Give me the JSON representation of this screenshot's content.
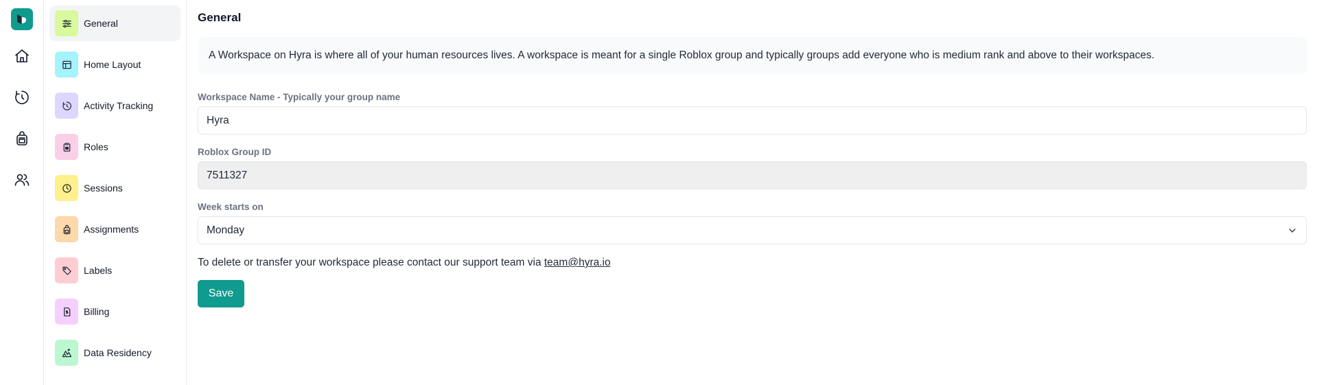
{
  "rail": {
    "logo": "hyra-logo",
    "items": [
      {
        "icon": "home-icon"
      },
      {
        "icon": "activity-icon"
      },
      {
        "icon": "backpack-icon"
      },
      {
        "icon": "users-icon"
      }
    ]
  },
  "settings_nav": {
    "items": [
      {
        "label": "General",
        "icon": "sliders-icon",
        "color": "#d9f99d",
        "active": true
      },
      {
        "label": "Home Layout",
        "icon": "layout-icon",
        "color": "#a5f3fc"
      },
      {
        "label": "Activity Tracking",
        "icon": "activity-icon",
        "color": "#ddd6fe"
      },
      {
        "label": "Roles",
        "icon": "clipboard-icon",
        "color": "#fbcfe8"
      },
      {
        "label": "Sessions",
        "icon": "clock-icon",
        "color": "#fef08a"
      },
      {
        "label": "Assignments",
        "icon": "backpack-icon",
        "color": "#fed7aa"
      },
      {
        "label": "Labels",
        "icon": "tag-icon",
        "color": "#fecdd3"
      },
      {
        "label": "Billing",
        "icon": "receipt-icon",
        "color": "#f5d0fe"
      },
      {
        "label": "Data Residency",
        "icon": "mountain-icon",
        "color": "#bbf7d0"
      }
    ]
  },
  "main": {
    "title": "General",
    "info": "A Workspace on Hyra is where all of your human resources lives. A workspace is meant for a single Roblox group and typically groups add everyone who is medium rank and above to their workspaces.",
    "workspace_name": {
      "label": "Workspace Name - Typically your group name",
      "value": "Hyra"
    },
    "group_id": {
      "label": "Roblox Group ID",
      "value": "7511327"
    },
    "week_start": {
      "label": "Week starts on",
      "value": "Monday"
    },
    "contact_text": "To delete or transfer your workspace please contact our support team via ",
    "contact_email": "team@hyra.io",
    "save_label": "Save"
  },
  "colors": {
    "accent": "#0f9b8e"
  }
}
